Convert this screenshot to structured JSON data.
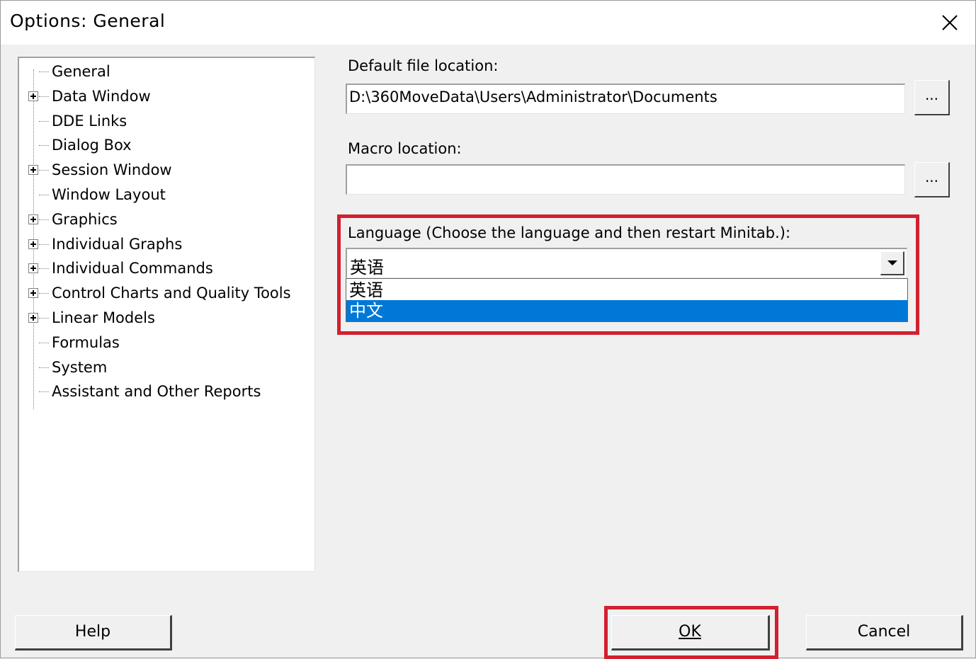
{
  "window": {
    "title": "Options: General"
  },
  "tree": {
    "items": [
      {
        "label": "General",
        "expandable": false
      },
      {
        "label": "Data Window",
        "expandable": true
      },
      {
        "label": "DDE Links",
        "expandable": false
      },
      {
        "label": "Dialog Box",
        "expandable": false
      },
      {
        "label": "Session Window",
        "expandable": true
      },
      {
        "label": "Window Layout",
        "expandable": false
      },
      {
        "label": "Graphics",
        "expandable": true
      },
      {
        "label": "Individual Graphs",
        "expandable": true
      },
      {
        "label": "Individual Commands",
        "expandable": true
      },
      {
        "label": "Control Charts and Quality Tools",
        "expandable": true
      },
      {
        "label": "Linear Models",
        "expandable": true
      },
      {
        "label": "Formulas",
        "expandable": false
      },
      {
        "label": "System",
        "expandable": false
      },
      {
        "label": "Assistant and Other Reports",
        "expandable": false
      }
    ]
  },
  "default_file": {
    "label": "Default file location:",
    "value": "D:\\360MoveData\\Users\\Administrator\\Documents",
    "browse": "..."
  },
  "macro": {
    "label": "Macro location:",
    "value": "",
    "browse": "..."
  },
  "language": {
    "label": "Language (Choose the language and then restart Minitab.):",
    "selected": "英语",
    "options": [
      "英语",
      "中文"
    ],
    "highlighted_option": "中文"
  },
  "buttons": {
    "help": "Help",
    "ok": "OK",
    "cancel": "Cancel"
  },
  "colors": {
    "highlight_box": "#d2202f",
    "selection": "#0078d7"
  }
}
